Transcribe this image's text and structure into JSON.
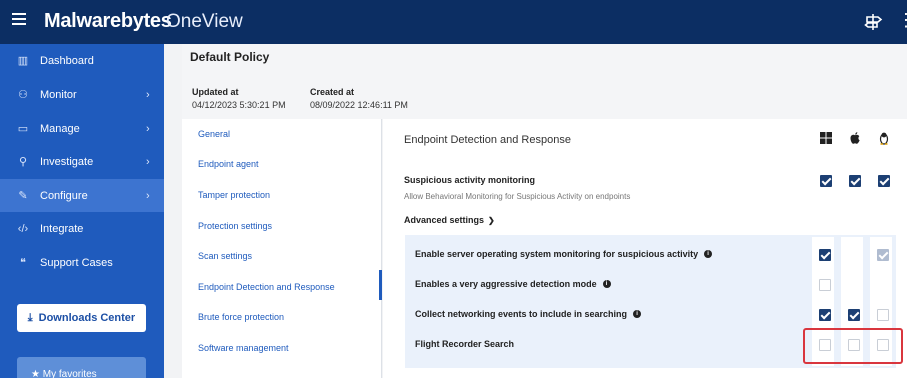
{
  "header": {
    "brand": "Malwarebytes",
    "product": "OneView",
    "icons": [
      "menu-icon",
      "signpost-icon",
      "more-icon"
    ]
  },
  "sidebar": {
    "items": [
      {
        "label": "Dashboard",
        "icon": "chart-icon",
        "chevron": false
      },
      {
        "label": "Monitor",
        "icon": "binoculars-icon",
        "chevron": true
      },
      {
        "label": "Manage",
        "icon": "laptop-icon",
        "chevron": true
      },
      {
        "label": "Investigate",
        "icon": "search-icon",
        "chevron": true
      },
      {
        "label": "Configure",
        "icon": "wrench-icon",
        "chevron": true,
        "active": true
      },
      {
        "label": "Integrate",
        "icon": "code-icon",
        "chevron": false
      },
      {
        "label": "Support Cases",
        "icon": "chat-icon",
        "chevron": false
      }
    ],
    "downloads_button": "Downloads Center",
    "favorites_label": "My favorites"
  },
  "policy": {
    "title": "Default Policy",
    "updated_label": "Updated at",
    "updated_value": "04/12/2023 5:30:21 PM",
    "created_label": "Created at",
    "created_value": "08/09/2022 12:46:11 PM"
  },
  "left_nav": {
    "items": [
      "General",
      "Endpoint agent",
      "Tamper protection",
      "Protection settings",
      "Scan settings",
      "Endpoint Detection and Response",
      "Brute force protection",
      "Software management"
    ],
    "selected": "Endpoint Detection and Response"
  },
  "edr": {
    "section_title": "Endpoint Detection and Response",
    "os_columns": [
      "windows-icon",
      "apple-icon",
      "linux-icon"
    ],
    "suspicious": {
      "title": "Suspicious activity monitoring",
      "description": "Allow Behavioral Monitoring for Suspicious Activity on endpoints",
      "states": [
        "checked",
        "checked",
        "checked"
      ]
    },
    "advanced_label": "Advanced settings",
    "advanced_rows": [
      {
        "label": "Enable server operating system monitoring for suspicious activity",
        "info": true,
        "states": [
          "checked",
          "none",
          "disabled-checked"
        ]
      },
      {
        "label": "Enables a very aggressive detection mode",
        "info": true,
        "states": [
          "unchecked",
          "none",
          "none"
        ]
      },
      {
        "label": "Collect networking events to include in searching",
        "info": true,
        "states": [
          "checked",
          "checked",
          "unchecked"
        ]
      },
      {
        "label": "Flight Recorder Search",
        "info": false,
        "states": [
          "unchecked",
          "unchecked",
          "unchecked"
        ]
      }
    ]
  },
  "colors": {
    "topbar": "#0c2e63",
    "sidebar": "#1f5bbd",
    "checkbox_checked": "#1c3f73",
    "highlight": "#d9363e"
  }
}
